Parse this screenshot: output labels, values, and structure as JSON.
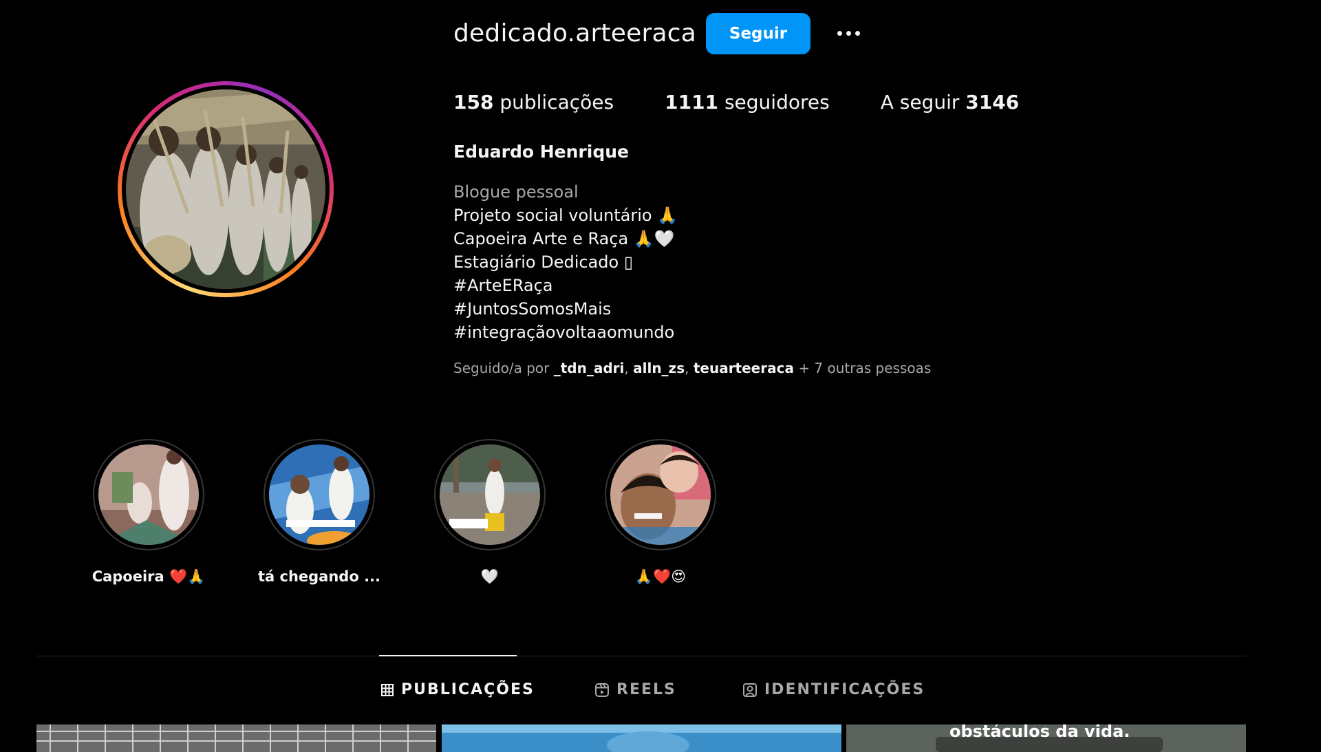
{
  "profile": {
    "username": "dedicado.arteeraca",
    "follow_label": "Seguir",
    "stats": {
      "posts_count": "158",
      "posts_label": "publicações",
      "followers_count": "1111",
      "followers_label": "seguidores",
      "following_label": "A seguir",
      "following_count": "3146"
    },
    "full_name": "Eduardo Henrique",
    "bio": {
      "category": "Blogue pessoal",
      "lines": [
        "Projeto social voluntário 🙏",
        "Capoeira Arte e Raça 🙏🤍",
        "Estagiário Dedicado ▯",
        "#ArteERaça",
        "#JuntosSomosMais",
        "#integraçãovoltaaomundo"
      ]
    },
    "followed_by": {
      "prefix": "Seguido/a por",
      "users": [
        "_tdn_adri",
        "alln_zs",
        "teuarteeraca"
      ],
      "suffix": "+ 7 outras pessoas"
    }
  },
  "highlights": [
    {
      "label": "Capoeira ❤️🙏"
    },
    {
      "label": "tá chegando ..."
    },
    {
      "label": "🤍"
    },
    {
      "label": "🙏❤️😍"
    }
  ],
  "tabs": [
    {
      "label": "PUBLICAÇÕES",
      "icon": "grid-icon",
      "active": true
    },
    {
      "label": "REELS",
      "icon": "reels-icon",
      "active": false
    },
    {
      "label": "IDENTIFICAÇÕES",
      "icon": "tagged-icon",
      "active": false
    }
  ],
  "posts": [
    {
      "overlay_text": ""
    },
    {
      "overlay_text": ""
    },
    {
      "overlay_text": "obstáculos da vida."
    }
  ],
  "colors": {
    "background": "#000000",
    "accent": "#0095f6",
    "text_primary": "#f5f5f5",
    "text_secondary": "#a8a8a8"
  }
}
